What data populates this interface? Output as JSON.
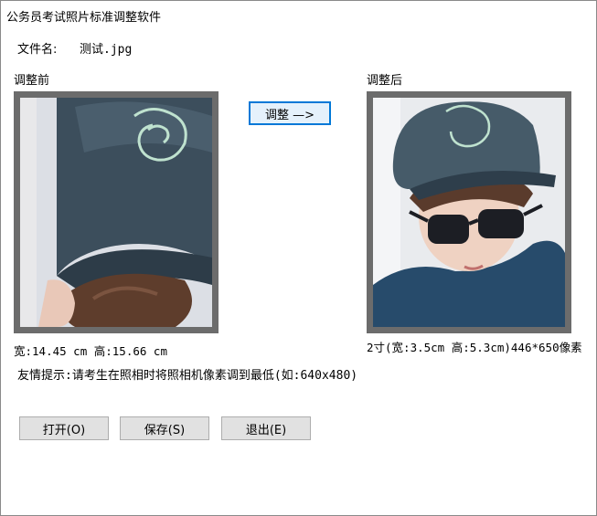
{
  "window": {
    "title": "公务员考试照片标准调整软件"
  },
  "file": {
    "label": "文件名:",
    "value": "测试.jpg"
  },
  "before": {
    "heading": "调整前",
    "info": "宽:14.45 cm 高:15.66 cm"
  },
  "after": {
    "heading": "调整后",
    "info": "2寸(宽:3.5cm 高:5.3cm)446*650像素"
  },
  "adjust_button": "调整 —>",
  "tip": "友情提示:请考生在照相时将照相机像素调到最低(如:640x480)",
  "buttons": {
    "open": "打开(O)",
    "save": "保存(S)",
    "exit": "退出(E)"
  }
}
